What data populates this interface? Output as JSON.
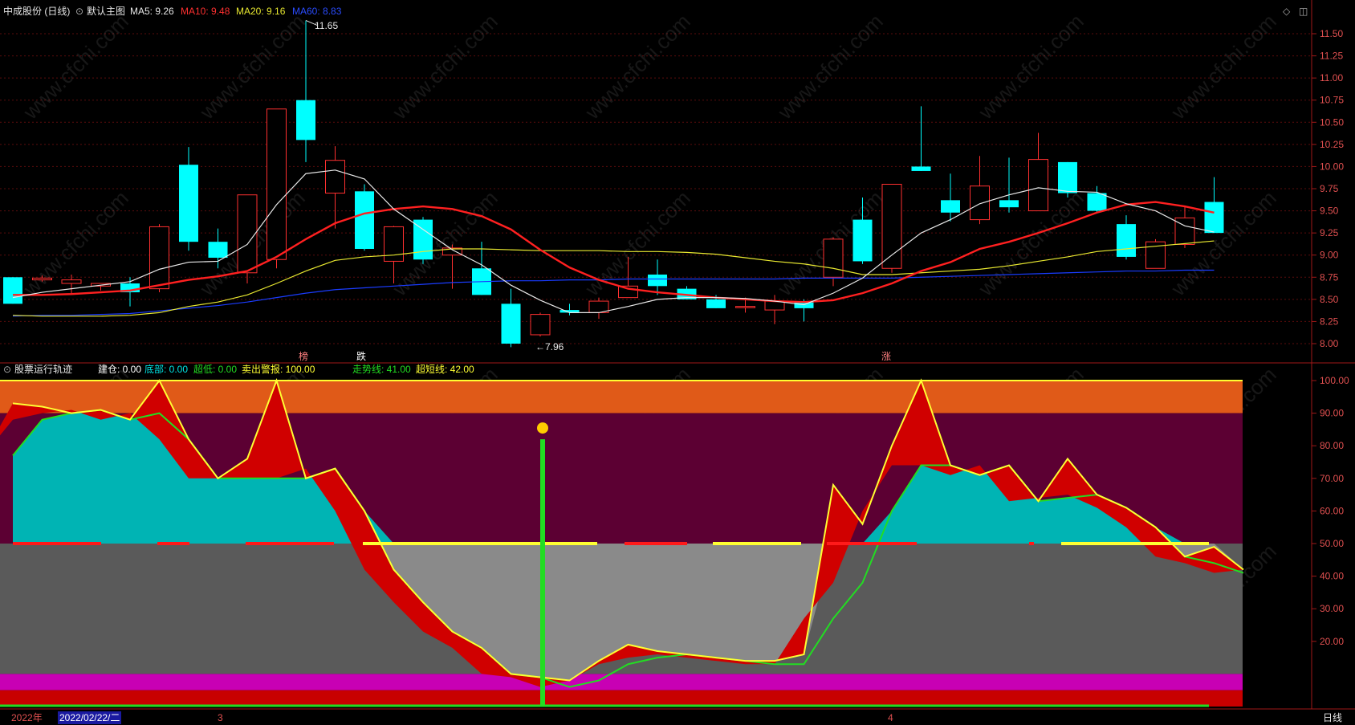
{
  "header": {
    "stock_title": "中成股份 (日线)",
    "main_label": "默认主图",
    "ma5": "MA5: 9.26",
    "ma10": "MA10: 9.48",
    "ma20": "MA20: 9.16",
    "ma60": "MA60: 8.83"
  },
  "indicator": {
    "title": "股票运行轨迹",
    "items": [
      {
        "text": "建仓: 0.00",
        "color": "#ffffff"
      },
      {
        "text": "底部: 0.00",
        "color": "#00e5e5"
      },
      {
        "text": "超低: 0.00",
        "color": "#22dd22"
      },
      {
        "text": "卖出警报: 100.00",
        "color": "#ffff33"
      },
      {
        "text": "走势线: 41.00",
        "color": "#22dd22"
      },
      {
        "text": "超短线: 42.00",
        "color": "#ffff33"
      }
    ]
  },
  "annotations": {
    "high_price": "11.65",
    "low_price": "←7.96",
    "signal_1": "榜",
    "signal_2": "跌",
    "signal_3": "涨"
  },
  "footer": {
    "year": "2022年",
    "cursor_date": "2022/02/22/二",
    "month_3": "3",
    "month_4": "4",
    "period": "日线"
  },
  "watermark": "www.cfchi.com",
  "colors": {
    "up": "#ff3030",
    "down": "#00ffff",
    "ma5": "#e8e8e8",
    "ma10": "#ff2020",
    "ma20": "#e8e830",
    "ma60": "#1a3cff",
    "orange_band": "#e05a18",
    "maroon_band": "#5c0033",
    "gray_band": "#5a5a5a",
    "magenta_band": "#c800b4",
    "red_band": "#c80000",
    "teal_fill": "#00b4b4",
    "green_line": "#22dd22"
  },
  "chart_data": [
    {
      "type": "candlestick",
      "y_ticks": [
        "11.50",
        "11.25",
        "11.00",
        "10.75",
        "10.50",
        "10.25",
        "10.00",
        "9.75",
        "9.50",
        "9.25",
        "9.00",
        "8.75",
        "8.50",
        "8.25",
        "8.00"
      ],
      "ylim": [
        7.85,
        11.7
      ],
      "candles": [
        {
          "o": 8.75,
          "h": 8.75,
          "l": 8.45,
          "c": 8.45
        },
        {
          "o": 8.72,
          "h": 8.77,
          "l": 8.7,
          "c": 8.74
        },
        {
          "o": 8.68,
          "h": 8.78,
          "l": 8.55,
          "c": 8.72
        },
        {
          "o": 8.65,
          "h": 8.68,
          "l": 8.6,
          "c": 8.68
        },
        {
          "o": 8.68,
          "h": 8.75,
          "l": 8.42,
          "c": 8.58
        },
        {
          "o": 8.62,
          "h": 9.35,
          "l": 8.58,
          "c": 9.32
        },
        {
          "o": 10.02,
          "h": 10.22,
          "l": 9.05,
          "c": 9.15
        },
        {
          "o": 9.15,
          "h": 9.3,
          "l": 8.85,
          "c": 8.97
        },
        {
          "o": 8.8,
          "h": 9.68,
          "l": 8.68,
          "c": 9.68
        },
        {
          "o": 8.95,
          "h": 10.65,
          "l": 8.85,
          "c": 10.65
        },
        {
          "o": 10.75,
          "h": 11.65,
          "l": 10.05,
          "c": 10.3
        },
        {
          "o": 9.7,
          "h": 10.23,
          "l": 9.3,
          "c": 10.07
        },
        {
          "o": 9.72,
          "h": 9.8,
          "l": 9.05,
          "c": 9.07
        },
        {
          "o": 8.93,
          "h": 9.33,
          "l": 8.68,
          "c": 9.32
        },
        {
          "o": 9.4,
          "h": 9.43,
          "l": 8.9,
          "c": 8.95
        },
        {
          "o": 9.0,
          "h": 9.12,
          "l": 8.62,
          "c": 9.08
        },
        {
          "o": 8.85,
          "h": 9.15,
          "l": 8.55,
          "c": 8.55
        },
        {
          "o": 8.45,
          "h": 8.62,
          "l": 7.96,
          "c": 8.0
        },
        {
          "o": 8.1,
          "h": 8.35,
          "l": 8.08,
          "c": 8.33
        },
        {
          "o": 8.38,
          "h": 8.45,
          "l": 8.32,
          "c": 8.35
        },
        {
          "o": 8.35,
          "h": 8.52,
          "l": 8.28,
          "c": 8.48
        },
        {
          "o": 8.52,
          "h": 8.98,
          "l": 8.52,
          "c": 8.65
        },
        {
          "o": 8.78,
          "h": 8.95,
          "l": 8.55,
          "c": 8.65
        },
        {
          "o": 8.62,
          "h": 8.65,
          "l": 8.5,
          "c": 8.5
        },
        {
          "o": 8.5,
          "h": 8.55,
          "l": 8.4,
          "c": 8.4
        },
        {
          "o": 8.42,
          "h": 8.52,
          "l": 8.35,
          "c": 8.42
        },
        {
          "o": 8.38,
          "h": 8.55,
          "l": 8.22,
          "c": 8.48
        },
        {
          "o": 8.48,
          "h": 8.5,
          "l": 8.25,
          "c": 8.4
        },
        {
          "o": 8.75,
          "h": 9.2,
          "l": 8.65,
          "c": 9.18
        },
        {
          "o": 9.4,
          "h": 9.65,
          "l": 8.9,
          "c": 8.93
        },
        {
          "o": 8.85,
          "h": 9.8,
          "l": 8.8,
          "c": 9.8
        },
        {
          "o": 10.0,
          "h": 10.68,
          "l": 9.95,
          "c": 9.95
        },
        {
          "o": 9.62,
          "h": 9.92,
          "l": 9.38,
          "c": 9.48
        },
        {
          "o": 9.4,
          "h": 10.12,
          "l": 9.35,
          "c": 9.78
        },
        {
          "o": 9.62,
          "h": 10.1,
          "l": 9.48,
          "c": 9.54
        },
        {
          "o": 9.5,
          "h": 10.38,
          "l": 9.5,
          "c": 10.08
        },
        {
          "o": 10.05,
          "h": 10.05,
          "l": 9.65,
          "c": 9.7
        },
        {
          "o": 9.7,
          "h": 9.78,
          "l": 9.48,
          "c": 9.5
        },
        {
          "o": 9.35,
          "h": 9.45,
          "l": 8.95,
          "c": 8.98
        },
        {
          "o": 8.85,
          "h": 9.18,
          "l": 8.85,
          "c": 9.15
        },
        {
          "o": 9.12,
          "h": 9.55,
          "l": 9.08,
          "c": 9.42
        },
        {
          "o": 9.6,
          "h": 9.88,
          "l": 9.25,
          "c": 9.25
        }
      ],
      "ma5": [
        8.52,
        8.58,
        8.62,
        8.66,
        8.7,
        8.84,
        8.92,
        8.93,
        9.12,
        9.57,
        9.92,
        9.96,
        9.86,
        9.52,
        9.29,
        9.06,
        8.89,
        8.66,
        8.49,
        8.35,
        8.35,
        8.42,
        8.5,
        8.52,
        8.52,
        8.51,
        8.48,
        8.44,
        8.57,
        8.74,
        9.0,
        9.25,
        9.4,
        9.58,
        9.68,
        9.76,
        9.72,
        9.71,
        9.58,
        9.5,
        9.33,
        9.26
      ],
      "ma10": [
        8.55,
        8.55,
        8.56,
        8.58,
        8.6,
        8.66,
        8.72,
        8.76,
        8.82,
        8.98,
        9.18,
        9.36,
        9.47,
        9.52,
        9.55,
        9.52,
        9.44,
        9.29,
        9.06,
        8.86,
        8.72,
        8.62,
        8.58,
        8.55,
        8.52,
        8.5,
        8.48,
        8.47,
        8.49,
        8.57,
        8.68,
        8.82,
        8.92,
        9.07,
        9.15,
        9.25,
        9.36,
        9.48,
        9.57,
        9.6,
        9.55,
        9.48
      ],
      "ma20": [
        8.32,
        8.31,
        8.31,
        8.31,
        8.32,
        8.35,
        8.42,
        8.47,
        8.55,
        8.68,
        8.82,
        8.94,
        8.98,
        9.0,
        9.04,
        9.07,
        9.07,
        9.06,
        9.05,
        9.05,
        9.05,
        9.04,
        9.04,
        9.03,
        9.01,
        8.97,
        8.93,
        8.9,
        8.85,
        8.78,
        8.78,
        8.8,
        8.82,
        8.84,
        8.88,
        8.93,
        8.98,
        9.04,
        9.07,
        9.1,
        9.13,
        9.16
      ],
      "ma60": [
        8.31,
        8.32,
        8.32,
        8.33,
        8.34,
        8.37,
        8.4,
        8.43,
        8.47,
        8.52,
        8.57,
        8.61,
        8.63,
        8.65,
        8.67,
        8.69,
        8.7,
        8.71,
        8.71,
        8.72,
        8.72,
        8.73,
        8.73,
        8.73,
        8.73,
        8.73,
        8.73,
        8.74,
        8.74,
        8.74,
        8.74,
        8.75,
        8.76,
        8.77,
        8.78,
        8.79,
        8.8,
        8.81,
        8.82,
        8.82,
        8.83,
        8.83
      ]
    },
    {
      "type": "area",
      "y_ticks": [
        "100.00",
        "90.00",
        "80.00",
        "70.00",
        "60.00",
        "50.00",
        "40.00",
        "30.00",
        "20.00"
      ],
      "ylim": [
        0,
        100
      ],
      "bands": [
        {
          "from": 90,
          "to": 100,
          "color": "orange_band"
        },
        {
          "from": 50,
          "to": 90,
          "color": "maroon_band"
        },
        {
          "from": 10,
          "to": 50,
          "color": "gray_band"
        },
        {
          "from": 5,
          "to": 10,
          "color": "magenta_band"
        },
        {
          "from": 0,
          "to": 5,
          "color": "red_band"
        }
      ],
      "short_line": [
        93,
        92,
        90,
        91,
        88,
        100,
        82,
        70,
        76,
        100,
        70,
        73,
        60,
        42,
        32,
        23,
        18,
        10,
        9,
        8,
        14,
        19,
        17,
        16,
        15,
        14,
        14,
        16,
        68,
        56,
        80,
        100,
        74,
        71,
        74,
        63,
        76,
        65,
        61,
        55,
        46,
        49,
        42
      ],
      "trend_line": [
        77,
        88,
        90,
        91,
        88,
        90,
        82,
        70,
        70,
        70,
        70,
        73,
        60,
        42,
        32,
        23,
        18,
        10,
        9,
        6,
        8,
        13,
        15,
        16,
        15,
        14,
        13,
        13,
        27,
        38,
        60,
        74,
        74,
        71,
        74,
        63,
        64,
        65,
        61,
        55,
        46,
        44,
        41
      ],
      "alert_marker_value": 82
    }
  ]
}
